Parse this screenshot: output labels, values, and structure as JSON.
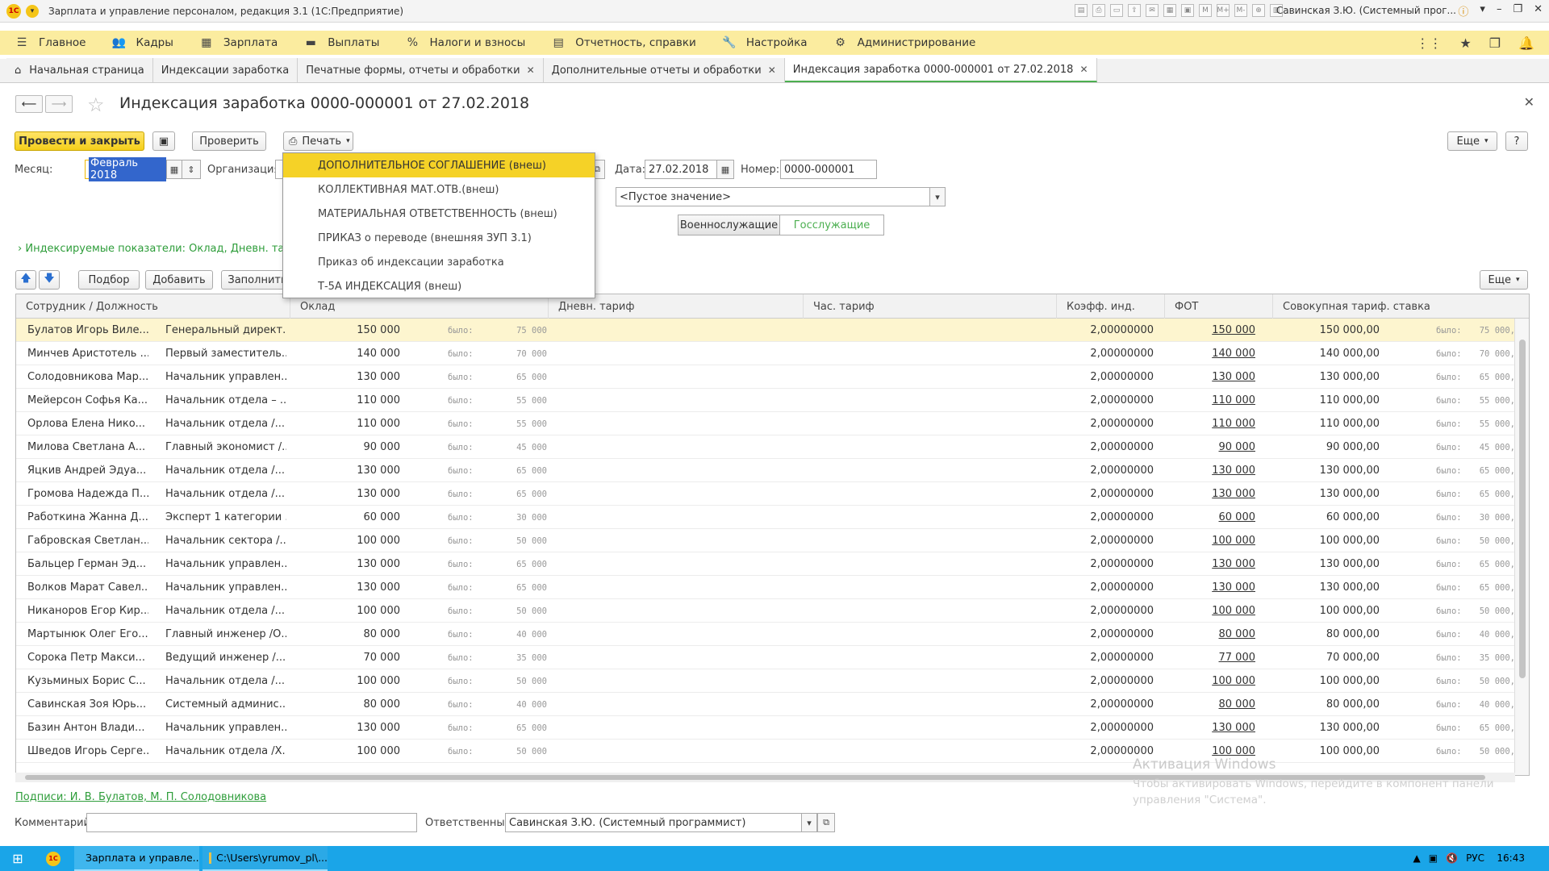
{
  "window": {
    "title": "Зарплата и управление персоналом, редакция 3.1  (1С:Предприятие)",
    "user": "Савинская З.Ю. (Системный прог..."
  },
  "sections": [
    {
      "label": "Главное",
      "icon": "menu-icon"
    },
    {
      "label": "Кадры",
      "icon": "people-icon"
    },
    {
      "label": "Зарплата",
      "icon": "calculator-icon"
    },
    {
      "label": "Выплаты",
      "icon": "wallet-icon"
    },
    {
      "label": "Налоги и взносы",
      "icon": "percent-icon"
    },
    {
      "label": "Отчетность, справки",
      "icon": "report-icon"
    },
    {
      "label": "Настройка",
      "icon": "wrench-icon"
    },
    {
      "label": "Администрирование",
      "icon": "gear-icon"
    }
  ],
  "tabs": [
    {
      "label": "Начальная страница"
    },
    {
      "label": "Индексации заработка"
    },
    {
      "label": "Печатные формы, отчеты и обработки"
    },
    {
      "label": "Дополнительные отчеты и обработки"
    },
    {
      "label": "Индексация заработка 0000-000001 от 27.02.2018"
    }
  ],
  "form": {
    "title": "Индексация заработка 0000-000001 от 27.02.2018",
    "post_close": "Провести и закрыть",
    "check": "Проверить",
    "print": "Печать",
    "more": "Еще",
    "help": "?",
    "month_label": "Месяц:",
    "month_value": "Февраль 2018",
    "org_label": "Организация:",
    "date_label": "Дата:",
    "date_value": "27.02.2018",
    "number_label": "Номер:",
    "number_value": "0000-000001",
    "empty_value": "<Пустое значение>",
    "switch_military": "Военнослужащие",
    "switch_civil": "Госслужащие",
    "indexed_link": "Индексируемые показатели: Оклад, Дневн. тариф,",
    "pick": "Подбор",
    "add": "Добавить",
    "fill": "Заполнить",
    "signatures": "Подписи: И. В. Булатов, М. П. Солодовникова",
    "comment_label": "Комментарий:",
    "comment_value": "",
    "responsible_label": "Ответственный:",
    "responsible_value": "Савинская З.Ю. (Системный программист)"
  },
  "print_menu": [
    "ДОПОЛНИТЕЛЬНОЕ СОГЛАШЕНИЕ (внеш)",
    "КОЛЛЕКТИВНАЯ МАТ.ОТВ.(внеш)",
    "МАТЕРИАЛЬНАЯ ОТВЕТСТВЕННОСТЬ (внеш)",
    "ПРИКАЗ о переводе (внешняя ЗУП 3.1)",
    "Приказ об индексации заработка",
    "Т-5А ИНДЕКСАЦИЯ (внеш)"
  ],
  "table": {
    "headers": [
      "Сотрудник / Должность",
      "Оклад",
      "Дневн. тариф",
      "Час. тариф",
      "Коэфф. инд.",
      "ФОТ",
      "Совокупная тариф. ставка"
    ],
    "was_label": "было:",
    "rows": [
      {
        "name": "Булатов Игорь Виле...",
        "pos": "Генеральный директ...",
        "salary": "150 000",
        "was": "75 000",
        "coef": "2,00000000",
        "fot": "150 000",
        "total": "150 000,00",
        "was_total": "75 000,"
      },
      {
        "name": "Минчев Аристотель ...",
        "pos": "Первый заместитель...",
        "salary": "140 000",
        "was": "70 000",
        "coef": "2,00000000",
        "fot": "140 000",
        "total": "140 000,00",
        "was_total": "70 000,"
      },
      {
        "name": "Солодовникова Мар...",
        "pos": "Начальник управлен...",
        "salary": "130 000",
        "was": "65 000",
        "coef": "2,00000000",
        "fot": "130 000",
        "total": "130 000,00",
        "was_total": "65 000,"
      },
      {
        "name": "Мейерсон Софья Ка...",
        "pos": "Начальник отдела – ...",
        "salary": "110 000",
        "was": "55 000",
        "coef": "2,00000000",
        "fot": "110 000",
        "total": "110 000,00",
        "was_total": "55 000,"
      },
      {
        "name": "Орлова Елена Нико...",
        "pos": "Начальник отдела /...",
        "salary": "110 000",
        "was": "55 000",
        "coef": "2,00000000",
        "fot": "110 000",
        "total": "110 000,00",
        "was_total": "55 000,"
      },
      {
        "name": "Милова Светлана А...",
        "pos": "Главный экономист /...",
        "salary": "90 000",
        "was": "45 000",
        "coef": "2,00000000",
        "fot": "90 000",
        "total": "90 000,00",
        "was_total": "45 000,"
      },
      {
        "name": "Яцкив Андрей Эдуа...",
        "pos": "Начальник отдела /...",
        "salary": "130 000",
        "was": "65 000",
        "coef": "2,00000000",
        "fot": "130 000",
        "total": "130 000,00",
        "was_total": "65 000,"
      },
      {
        "name": "Громова Надежда П...",
        "pos": "Начальник отдела /...",
        "salary": "130 000",
        "was": "65 000",
        "coef": "2,00000000",
        "fot": "130 000",
        "total": "130 000,00",
        "was_total": "65 000,"
      },
      {
        "name": "Работкина Жанна Д...",
        "pos": "Эксперт 1 категории ...",
        "salary": "60 000",
        "was": "30 000",
        "coef": "2,00000000",
        "fot": "60 000",
        "total": "60 000,00",
        "was_total": "30 000,"
      },
      {
        "name": "Габровская Светлан...",
        "pos": "Начальник сектора /...",
        "salary": "100 000",
        "was": "50 000",
        "coef": "2,00000000",
        "fot": "100 000",
        "total": "100 000,00",
        "was_total": "50 000,"
      },
      {
        "name": "Бальцер Герман Эд...",
        "pos": "Начальник управлен...",
        "salary": "130 000",
        "was": "65 000",
        "coef": "2,00000000",
        "fot": "130 000",
        "total": "130 000,00",
        "was_total": "65 000,"
      },
      {
        "name": "Волков Марат Савел...",
        "pos": "Начальник управлен...",
        "salary": "130 000",
        "was": "65 000",
        "coef": "2,00000000",
        "fot": "130 000",
        "total": "130 000,00",
        "was_total": "65 000,"
      },
      {
        "name": "Никаноров Егор Кир...",
        "pos": "Начальник отдела /...",
        "salary": "100 000",
        "was": "50 000",
        "coef": "2,00000000",
        "fot": "100 000",
        "total": "100 000,00",
        "was_total": "50 000,"
      },
      {
        "name": "Мартынюк Олег Его...",
        "pos": "Главный инженер /О...",
        "salary": "80 000",
        "was": "40 000",
        "coef": "2,00000000",
        "fot": "80 000",
        "total": "80 000,00",
        "was_total": "40 000,"
      },
      {
        "name": "Сорока Петр Макси...",
        "pos": "Ведущий инженер /...",
        "salary": "70 000",
        "was": "35 000",
        "coef": "2,00000000",
        "fot": "77 000",
        "total": "70 000,00",
        "was_total": "35 000,"
      },
      {
        "name": "Кузьминых Борис С...",
        "pos": "Начальник отдела /...",
        "salary": "100 000",
        "was": "50 000",
        "coef": "2,00000000",
        "fot": "100 000",
        "total": "100 000,00",
        "was_total": "50 000,"
      },
      {
        "name": "Савинская Зоя Юрь...",
        "pos": "Системный админис...",
        "salary": "80 000",
        "was": "40 000",
        "coef": "2,00000000",
        "fot": "80 000",
        "total": "80 000,00",
        "was_total": "40 000,"
      },
      {
        "name": "Базин Антон Влади...",
        "pos": "Начальник управлен...",
        "salary": "130 000",
        "was": "65 000",
        "coef": "2,00000000",
        "fot": "130 000",
        "total": "130 000,00",
        "was_total": "65 000,"
      },
      {
        "name": "Шведов Игорь Серге...",
        "pos": "Начальник отдела /Х...",
        "salary": "100 000",
        "was": "50 000",
        "coef": "2,00000000",
        "fot": "100 000",
        "total": "100 000,00",
        "was_total": "50 000,"
      }
    ]
  },
  "watermark": {
    "title": "Активация Windows",
    "text": "Чтобы активировать Windows, перейдите в компонент панели управления \"Система\"."
  },
  "taskbar": {
    "task1": "Зарплата и управле...",
    "task2": "C:\\Users\\yrumov_pl\\...",
    "lang": "РУС",
    "clock": "16:43"
  }
}
